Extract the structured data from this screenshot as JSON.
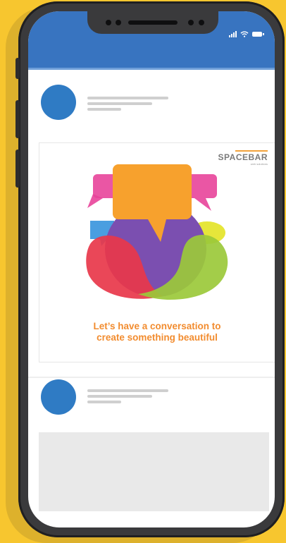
{
  "colors": {
    "background": "#f7c62f",
    "topbar": "#3874c0",
    "avatar": "#2f7bc4",
    "caption": "#f28c2f"
  },
  "status_bar": {
    "icons": [
      "signal-icon",
      "wifi-icon",
      "battery-icon"
    ]
  },
  "posts": [
    {
      "image": {
        "brand": "SPACEBAR",
        "brand_sub": "web solutions",
        "caption_line1": "Let’s have a conversation to",
        "caption_line2": "create something beautiful",
        "icons": [
          "speech-bubble-icon"
        ]
      }
    },
    {
      "image": null
    }
  ]
}
